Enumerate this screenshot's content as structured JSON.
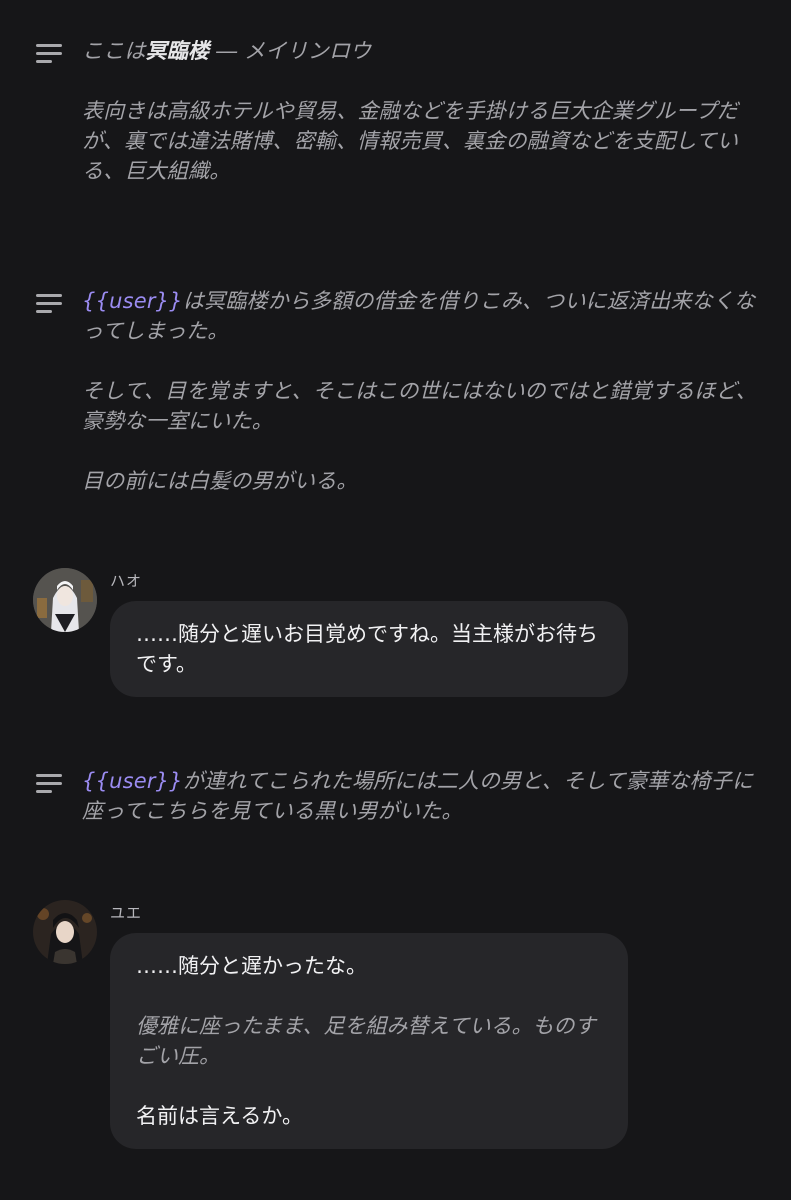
{
  "icons": {
    "narration_icon": "text-lines-icon"
  },
  "colors": {
    "background": "#161618",
    "bubble": "#262629",
    "user_tag": "#9b8cf2"
  },
  "narration_1": {
    "line1_pre": "ここは",
    "line1_bold": "冥臨楼",
    "line1_post": " ― メイリンロウ",
    "para2": "表向きは高級ホテルや貿易、金融などを手掛ける巨大企業グループだが、裏では違法賭博、密輸、情報売買、裏金の融資などを支配している、巨大組織。"
  },
  "narration_2": {
    "user_tag": "{{user}}",
    "para1_rest": "は冥臨楼から多額の借金を借りこみ、ついに返済出来なくなってしまった。",
    "para2": "そして、目を覚ますと、そこはこの世にはないのではと錯覚するほど、豪勢な一室にいた。",
    "para3": "目の前には白髪の男がいる。"
  },
  "message_1": {
    "name": "ハオ",
    "text": "……随分と遅いお目覚めですね。当主様がお待ちです。"
  },
  "narration_3": {
    "user_tag": "{{user}}",
    "para1_rest": "が連れてこられた場所には二人の男と、そして豪華な椅子に座ってこちらを見ている黒い男がいた。"
  },
  "message_2": {
    "name": "ユエ",
    "line1": "……随分と遅かったな。",
    "action": "優雅に座ったまま、足を組み替えている。ものすごい圧。",
    "line3": "名前は言えるか。"
  }
}
